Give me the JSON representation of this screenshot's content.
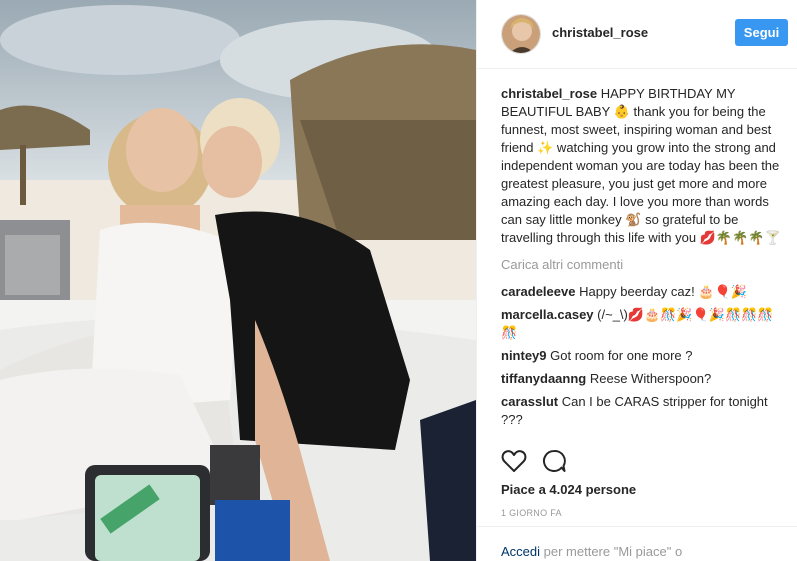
{
  "post": {
    "username": "christabel_rose",
    "follow_label": "Segui",
    "caption_text": "HAPPY BIRTHDAY MY BEAUTIFUL BABY 👶 thank you for being the funnest, most sweet, inspiring woman and best friend ✨ watching you grow into the strong and independent woman you are today has been the greatest pleasure, you just get more and more amazing each day. I love you more than words can say little monkey 🐒 so grateful to be travelling through this life with you 💋🌴🌴🌴🍸",
    "load_more": "Carica altri commenti",
    "comments": [
      {
        "user": "caradeleeve",
        "text": "Happy beerday caz! 🎂🎈🎉"
      },
      {
        "user": "marcella.casey",
        "text": "(/~_\\)💋🎂🎊🎉🎈🎉🎊🎊🎊🎊"
      },
      {
        "user": "nintey9",
        "text": "Got room for one more ?"
      },
      {
        "user": "tiffanydaanng",
        "text": "Reese Witherspoon?"
      },
      {
        "user": "carasslut",
        "text": "Can I be CARAS stripper for tonight ???"
      }
    ],
    "likes": "Piace a 4.024 persone",
    "time": "1 GIORNO FA",
    "login_link": "Accedi",
    "login_text": " per mettere \"Mi piace\" o"
  },
  "icons": {
    "like": "heart-icon",
    "comment": "comment-icon"
  },
  "colors": {
    "accent": "#3897f0",
    "link": "#003569",
    "muted": "#999999"
  }
}
